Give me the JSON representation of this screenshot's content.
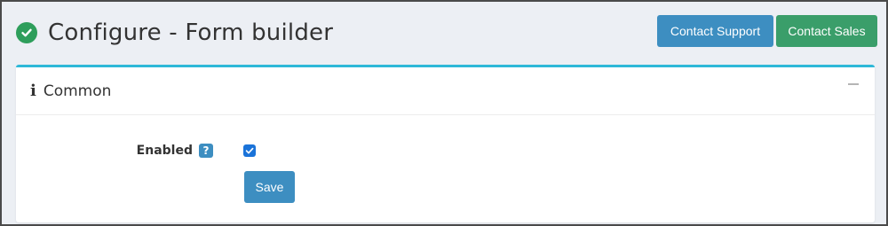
{
  "header": {
    "title": "Configure - Form builder",
    "title_icon": "check-circle-icon",
    "contact_support_label": "Contact Support",
    "contact_sales_label": "Contact Sales"
  },
  "panel": {
    "icon": "info-icon",
    "title": "Common",
    "collapse_icon": "minus-icon",
    "accent_color": "#2eb8d8"
  },
  "form": {
    "enabled_label": "Enabled",
    "help_icon": "question-icon",
    "enabled_checked": true,
    "save_label": "Save"
  },
  "colors": {
    "primary": "#3d8ec1",
    "success": "#3a9e6a",
    "checkbox": "#1a73d9"
  }
}
